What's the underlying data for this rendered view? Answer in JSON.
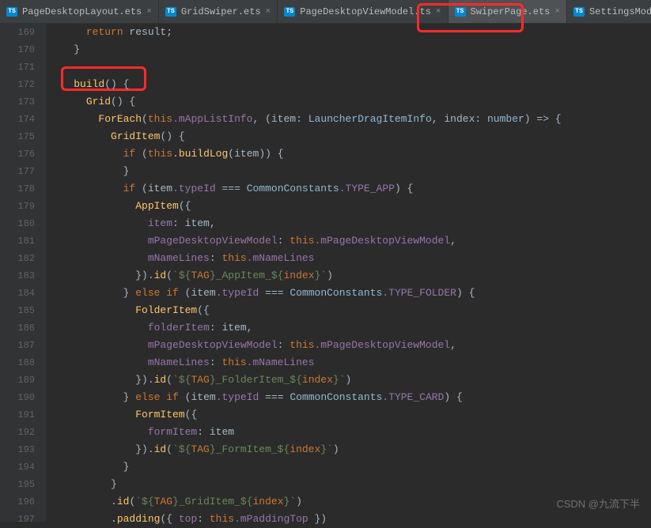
{
  "tabs": [
    {
      "label": "PageDesktopLayout.ets",
      "iconText": "TS",
      "close": "×"
    },
    {
      "label": "GridSwiper.ets",
      "iconText": "TS",
      "close": "×"
    },
    {
      "label": "PageDesktopViewModel.ts",
      "iconText": "TS",
      "close": "×"
    },
    {
      "label": "SwiperPage.ets",
      "iconText": "TS",
      "close": "×",
      "active": true
    },
    {
      "label": "SettingsModel.ts",
      "iconText": "TS",
      "close": "×"
    }
  ],
  "lines": [
    "169",
    "170",
    "171",
    "172",
    "173",
    "174",
    "175",
    "176",
    "177",
    "178",
    "179",
    "180",
    "181",
    "182",
    "183",
    "184",
    "185",
    "186",
    "187",
    "188",
    "189",
    "190",
    "191",
    "192",
    "193",
    "194",
    "195",
    "196",
    "197"
  ],
  "code": {
    "l169": "    return result;",
    "l170": "  }",
    "l171": "",
    "l172_fn": "build",
    "l173_grid": "Grid",
    "l174_fe": "ForEach",
    "l174_this": "this",
    "l174_prop": ".mAppListInfo",
    "l174_item": "item",
    "l174_t1": "LauncherDragItemInfo",
    "l174_idx": "index",
    "l174_t2": "number",
    "l175_gi": "GridItem",
    "l176_if": "if",
    "l176_this": "this",
    "l176_bl": "buildLog",
    "l176_item": "item",
    "l177": "          }",
    "l178_if": "if",
    "l178_item": "item",
    "l178_typeId": ".typeId",
    "l178_cc": "CommonConstants",
    "l178_ta": ".TYPE_APP",
    "l179_ai": "AppItem",
    "l180_k": "item",
    "l180_v": "item",
    "l181_k": "mPageDesktopViewModel",
    "l181_this": "this",
    "l181_v": ".mPageDesktopViewModel",
    "l182_k": "mNameLines",
    "l182_this": "this",
    "l182_v": ".mNameLines",
    "l183_id": "id",
    "l183_s1": "`${",
    "l183_tag": "TAG",
    "l183_s2": "}_AppItem_${",
    "l183_idx": "index",
    "l183_s3": "}`",
    "l184_else": "else",
    "l184_if": "if",
    "l184_item": "item",
    "l184_typeId": ".typeId",
    "l184_cc": "CommonConstants",
    "l184_tf": ".TYPE_FOLDER",
    "l185_fi": "FolderItem",
    "l186_k": "folderItem",
    "l186_v": "item",
    "l187_k": "mPageDesktopViewModel",
    "l187_this": "this",
    "l187_v": ".mPageDesktopViewModel",
    "l188_k": "mNameLines",
    "l188_this": "this",
    "l188_v": ".mNameLines",
    "l189_id": "id",
    "l189_s1": "`${",
    "l189_tag": "TAG",
    "l189_s2": "}_FolderItem_${",
    "l189_idx": "index",
    "l189_s3": "}`",
    "l190_else": "else",
    "l190_if": "if",
    "l190_item": "item",
    "l190_typeId": ".typeId",
    "l190_cc": "CommonConstants",
    "l190_tc": ".TYPE_CARD",
    "l191_fm": "FormItem",
    "l192_k": "formItem",
    "l192_v": "item",
    "l193_id": "id",
    "l193_s1": "`${",
    "l193_tag": "TAG",
    "l193_s2": "}_FormItem_${",
    "l193_idx": "index",
    "l193_s3": "}`",
    "l194": "          }",
    "l195": "        }",
    "l196_id": "id",
    "l196_s1": "`${",
    "l196_tag": "TAG",
    "l196_s2": "}_GridItem_${",
    "l196_idx": "index",
    "l196_s3": "}`",
    "l197_pad": "padding",
    "l197_top": "top",
    "l197_this": "this",
    "l197_v": ".mPaddingTop"
  },
  "watermark": "CSDN @九流下半"
}
